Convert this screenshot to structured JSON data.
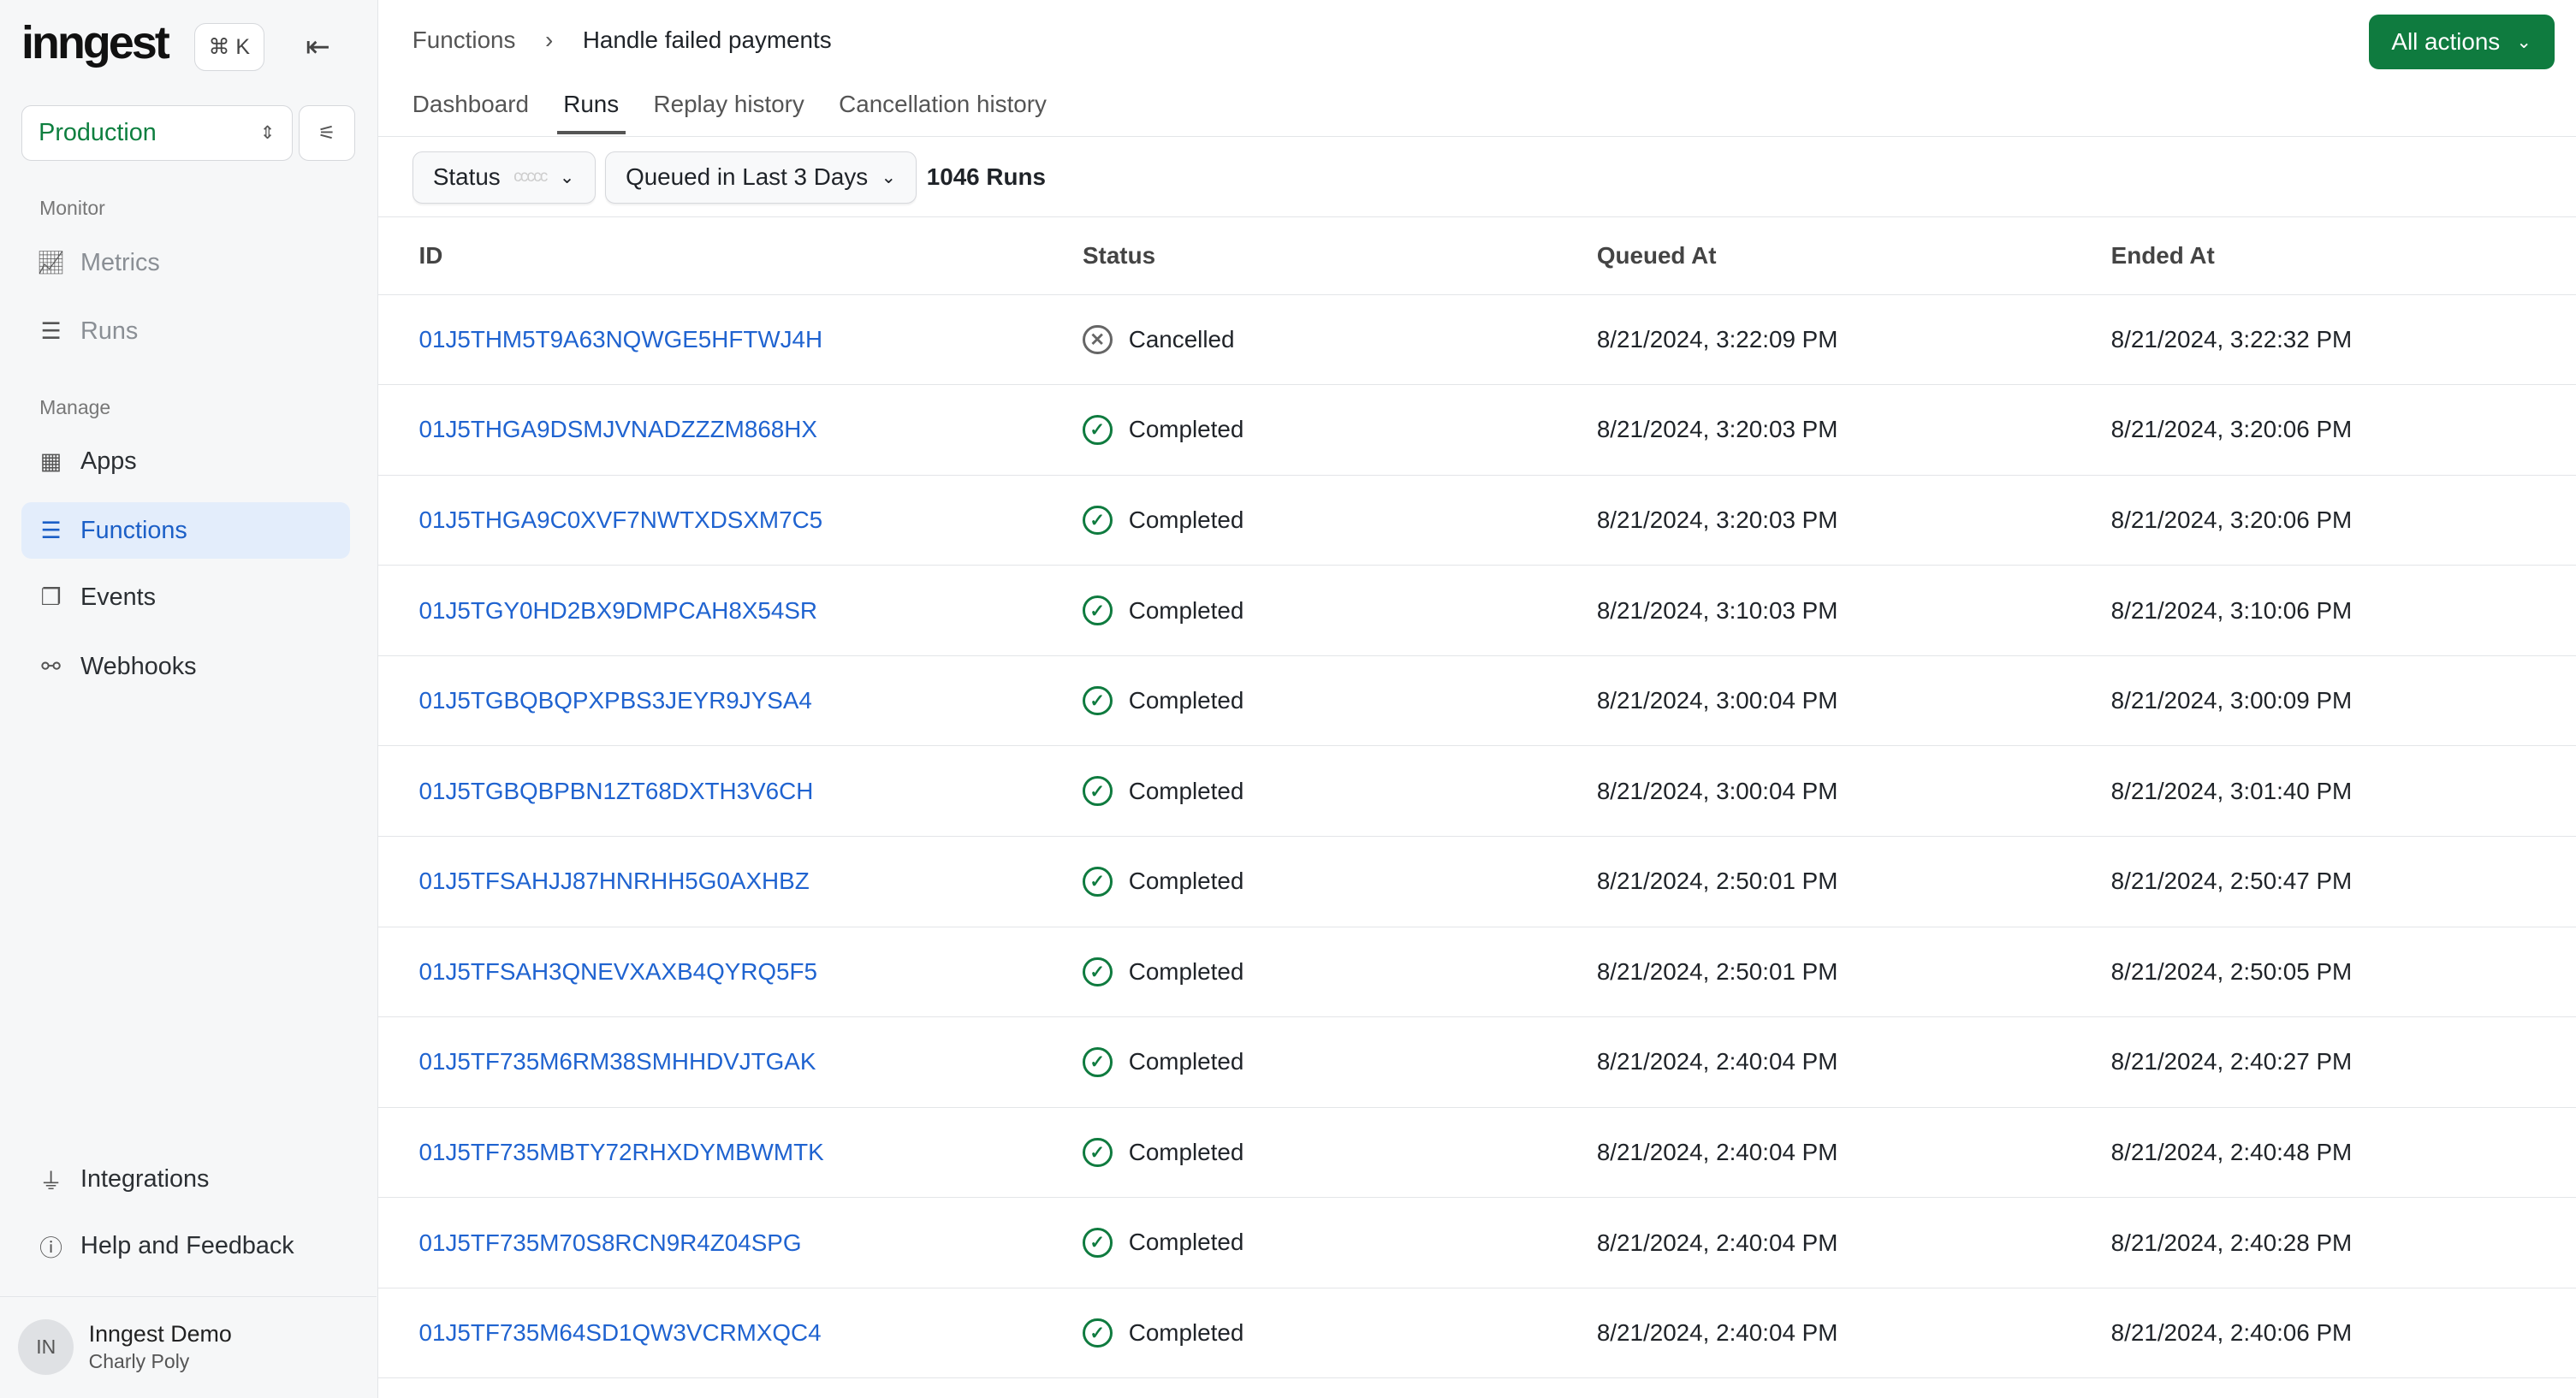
{
  "sidebar": {
    "logo": "inngest",
    "shortcut": "⌘ K",
    "environment": "Production",
    "monitor_label": "Monitor",
    "manage_label": "Manage",
    "items": [
      {
        "label": "Metrics"
      },
      {
        "label": "Runs"
      },
      {
        "label": "Apps"
      },
      {
        "label": "Functions"
      },
      {
        "label": "Events"
      },
      {
        "label": "Webhooks"
      },
      {
        "label": "Integrations"
      },
      {
        "label": "Help and Feedback"
      }
    ],
    "user": {
      "initials": "IN",
      "name": "Inngest Demo",
      "sub": "Charly Poly"
    }
  },
  "header": {
    "breadcrumb_root": "Functions",
    "breadcrumb_current": "Handle failed payments",
    "all_actions": "All actions"
  },
  "tabs": [
    "Dashboard",
    "Runs",
    "Replay history",
    "Cancellation history"
  ],
  "filters": {
    "status": "Status",
    "status_placeholder": "ccccc",
    "time": "Queued in Last 3 Days",
    "count": "1046 Runs"
  },
  "table": {
    "headers": [
      "ID",
      "Status",
      "Queued At",
      "Ended At"
    ],
    "rows": [
      {
        "id": "01J5THM5T9A63NQWGE5HFTWJ4H",
        "status": "Cancelled",
        "queued": "8/21/2024, 3:22:09 PM",
        "ended": "8/21/2024, 3:22:32 PM"
      },
      {
        "id": "01J5THGA9DSMJVNADZZZM868HX",
        "status": "Completed",
        "queued": "8/21/2024, 3:20:03 PM",
        "ended": "8/21/2024, 3:20:06 PM"
      },
      {
        "id": "01J5THGA9C0XVF7NWTXDSXM7C5",
        "status": "Completed",
        "queued": "8/21/2024, 3:20:03 PM",
        "ended": "8/21/2024, 3:20:06 PM"
      },
      {
        "id": "01J5TGY0HD2BX9DMPCAH8X54SR",
        "status": "Completed",
        "queued": "8/21/2024, 3:10:03 PM",
        "ended": "8/21/2024, 3:10:06 PM"
      },
      {
        "id": "01J5TGBQBQPXPBS3JEYR9JYSA4",
        "status": "Completed",
        "queued": "8/21/2024, 3:00:04 PM",
        "ended": "8/21/2024, 3:00:09 PM"
      },
      {
        "id": "01J5TGBQBPBN1ZT68DXTH3V6CH",
        "status": "Completed",
        "queued": "8/21/2024, 3:00:04 PM",
        "ended": "8/21/2024, 3:01:40 PM"
      },
      {
        "id": "01J5TFSAHJJ87HNRHH5G0AXHBZ",
        "status": "Completed",
        "queued": "8/21/2024, 2:50:01 PM",
        "ended": "8/21/2024, 2:50:47 PM"
      },
      {
        "id": "01J5TFSAH3QNEVXAXB4QYRQ5F5",
        "status": "Completed",
        "queued": "8/21/2024, 2:50:01 PM",
        "ended": "8/21/2024, 2:50:05 PM"
      },
      {
        "id": "01J5TF735M6RM38SMHHDVJTGAK",
        "status": "Completed",
        "queued": "8/21/2024, 2:40:04 PM",
        "ended": "8/21/2024, 2:40:27 PM"
      },
      {
        "id": "01J5TF735MBTY72RHXDYMBWMTK",
        "status": "Completed",
        "queued": "8/21/2024, 2:40:04 PM",
        "ended": "8/21/2024, 2:40:48 PM"
      },
      {
        "id": "01J5TF735M70S8RCN9R4Z04SPG",
        "status": "Completed",
        "queued": "8/21/2024, 2:40:04 PM",
        "ended": "8/21/2024, 2:40:28 PM"
      },
      {
        "id": "01J5TF735M64SD1QW3VCRMXQC4",
        "status": "Completed",
        "queued": "8/21/2024, 2:40:04 PM",
        "ended": "8/21/2024, 2:40:06 PM"
      }
    ]
  },
  "colors": {
    "accent": "#0f7b3f",
    "link": "#1f63d0",
    "active_nav": "#e3edfb"
  }
}
